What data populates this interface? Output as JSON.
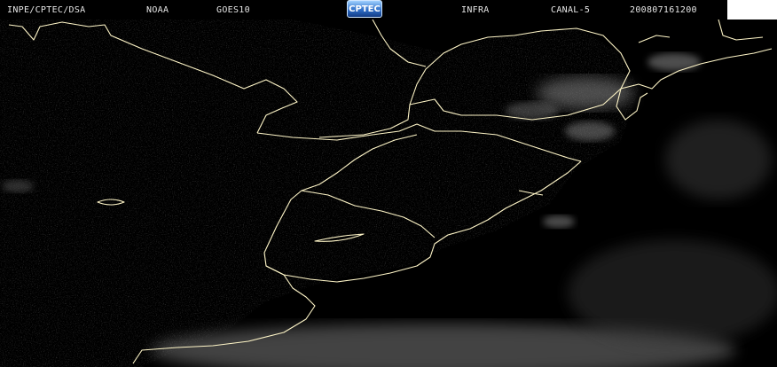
{
  "header": {
    "agency": "INPE/CPTEC/DSA",
    "operator": "NOAA",
    "satellite": "GOES10",
    "logo_text": "CPTEC",
    "product": "INFRA",
    "channel": "CANAL-5",
    "timestamp": "200807161200"
  },
  "colors": {
    "background": "#000000",
    "coastline": "#fff6c8",
    "header_text": "#e6e6e6"
  }
}
